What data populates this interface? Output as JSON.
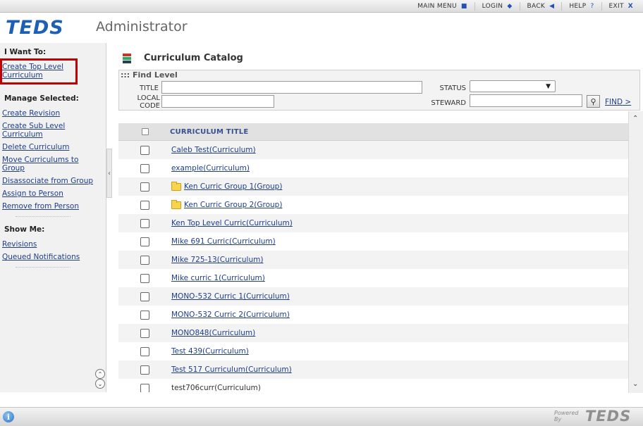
{
  "nav": {
    "items": [
      {
        "label": "MAIN MENU",
        "glyph": "■"
      },
      {
        "label": "LOGIN",
        "glyph": "◆"
      },
      {
        "label": "BACK",
        "glyph": "◀"
      },
      {
        "label": "HELP",
        "glyph": "?"
      },
      {
        "label": "EXIT",
        "glyph": "X"
      }
    ]
  },
  "header": {
    "logo": "TEDS",
    "subtitle": "Administrator"
  },
  "sidebar": {
    "i_want_to": "I Want To:",
    "create_top": "Create Top Level Curriculum",
    "manage_selected": "Manage Selected:",
    "manage_links": [
      "Create Revision",
      "Create Sub Level Curriculum",
      "Delete Curriculum",
      "Move Curriculums to Group",
      "Disassociate from Group",
      "Assign to Person",
      "Remove from Person"
    ],
    "show_me": "Show Me:",
    "show_links": [
      "Revisions",
      "Queued Notifications"
    ],
    "scroll_up": "⌃",
    "scroll_down": "⌄",
    "collapse": "‹"
  },
  "main": {
    "title": "Curriculum Catalog",
    "find": {
      "heading": "::: Find Level",
      "title_label": "TITLE",
      "title_value": "",
      "local_code_label": "LOCAL\nCODE",
      "local_code_value": "",
      "status_label": "STATUS",
      "status_value": "",
      "steward_label": "STEWARD",
      "steward_value": "",
      "find_link": "FIND >"
    },
    "table": {
      "header": "CURRICULUM TITLE",
      "rows": [
        {
          "label": "Caleb Test(Curriculum)",
          "folder": false,
          "link": true
        },
        {
          "label": "example(Curriculum)",
          "folder": false,
          "link": true
        },
        {
          "label": "Ken Curric Group 1(Group)",
          "folder": true,
          "link": true
        },
        {
          "label": "Ken Curric Group 2(Group)",
          "folder": true,
          "link": true
        },
        {
          "label": "Ken Top Level Curric(Curriculum)",
          "folder": false,
          "link": true
        },
        {
          "label": "Mike 691 Curric(Curriculum)",
          "folder": false,
          "link": true
        },
        {
          "label": "Mike 725-13(Curriculum)",
          "folder": false,
          "link": true
        },
        {
          "label": "Mike curric 1(Curriculum)",
          "folder": false,
          "link": true
        },
        {
          "label": "MONO-532 Curric 1(Curriculum)",
          "folder": false,
          "link": true
        },
        {
          "label": "MONO-532 Curric 2(Curriculum)",
          "folder": false,
          "link": true
        },
        {
          "label": "MONO848(Curriculum)",
          "folder": false,
          "link": true
        },
        {
          "label": "Test 439(Curriculum)",
          "folder": false,
          "link": true
        },
        {
          "label": "Test 517 Curriculum(Curriculum)",
          "folder": false,
          "link": true
        },
        {
          "label": "test706curr(Curriculum)",
          "folder": false,
          "link": false
        }
      ]
    }
  },
  "footer": {
    "info": "i",
    "powered_by": "Powered\nBy",
    "powered_logo": "TEDS"
  }
}
